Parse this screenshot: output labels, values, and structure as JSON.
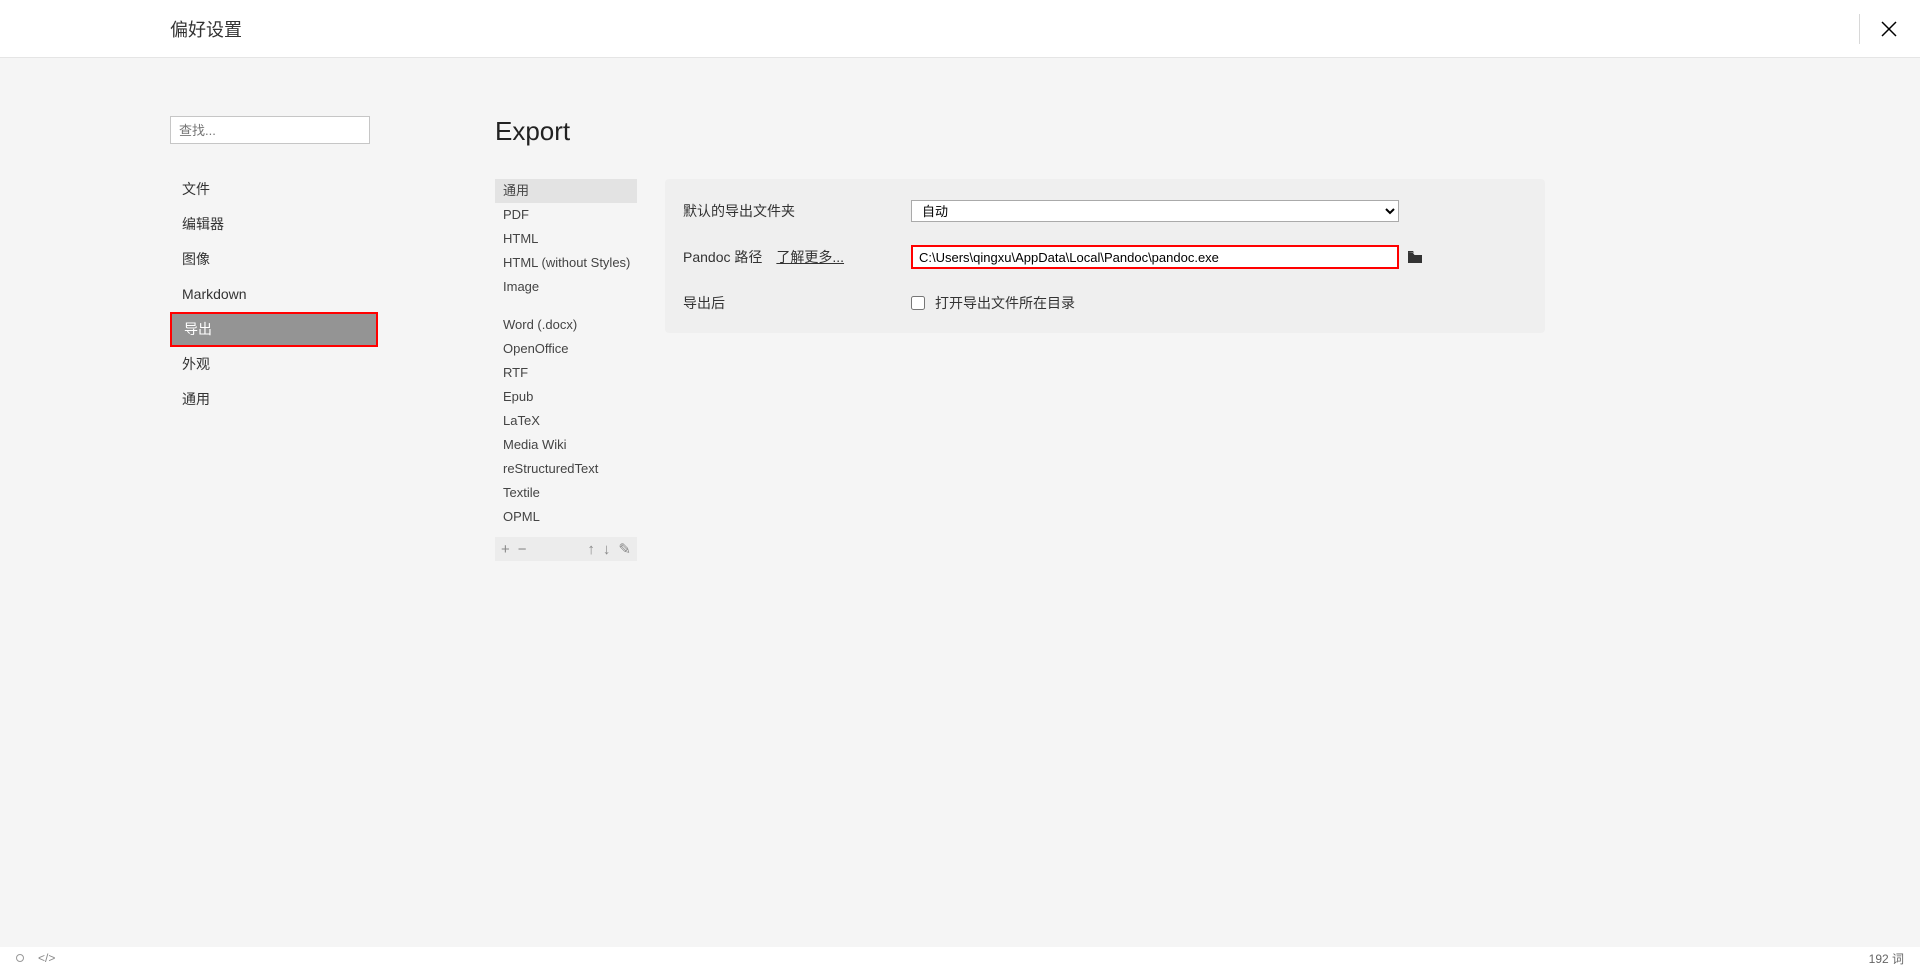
{
  "header": {
    "title": "偏好设置"
  },
  "sidebar": {
    "search_placeholder": "查找...",
    "items": [
      {
        "label": "文件"
      },
      {
        "label": "编辑器"
      },
      {
        "label": "图像"
      },
      {
        "label": "Markdown"
      },
      {
        "label": "导出"
      },
      {
        "label": "外观"
      },
      {
        "label": "通用"
      }
    ]
  },
  "content": {
    "title": "Export",
    "sections": {
      "general_header": "通用",
      "group1": [
        "PDF",
        "HTML",
        "HTML (without Styles)",
        "Image"
      ],
      "group2": [
        "Word (.docx)",
        "OpenOffice",
        "RTF",
        "Epub",
        "LaTeX",
        "Media Wiki",
        "reStructuredText",
        "Textile",
        "OPML"
      ]
    },
    "toolbar": {
      "plus": "+",
      "minus": "−",
      "up": "↑",
      "down": "↓",
      "edit": "✎"
    }
  },
  "settings": {
    "export_folder_label": "默认的导出文件夹",
    "export_folder_value": "自动",
    "pandoc_label": "Pandoc 路径",
    "pandoc_learn": "了解更多...",
    "pandoc_value": "C:\\Users\\qingxu\\AppData\\Local\\Pandoc\\pandoc.exe",
    "after_export_label": "导出后",
    "open_folder_label": "打开导出文件所在目录"
  },
  "statusbar": {
    "code_toggle": "</>",
    "word_count": "192 词"
  }
}
